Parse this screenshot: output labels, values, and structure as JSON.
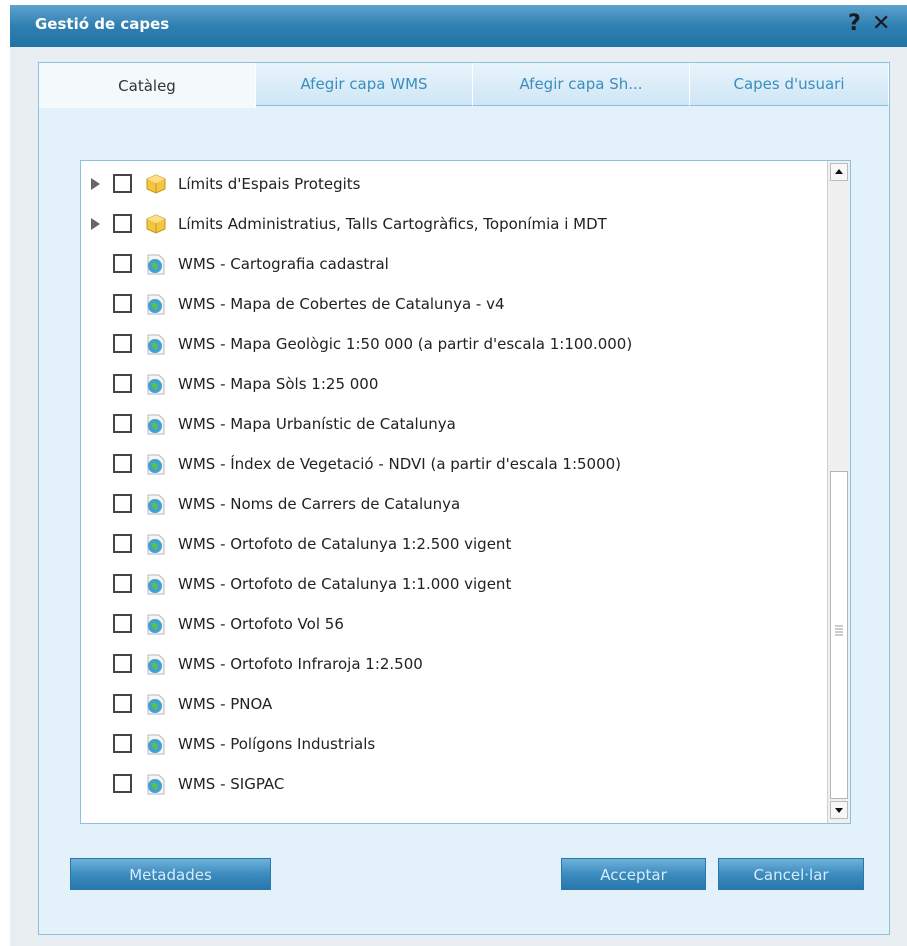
{
  "dialog": {
    "title": "Gestió de capes",
    "help_label": "?",
    "close_label": "✕",
    "tabs": [
      {
        "label": "Catàleg",
        "active": true
      },
      {
        "label": "Afegir capa WMS",
        "active": false
      },
      {
        "label": "Afegir capa Sh...",
        "active": false
      },
      {
        "label": "Capes d'usuari",
        "active": false
      }
    ],
    "layers": [
      {
        "label": "Límits d'Espais Protegits",
        "type": "group",
        "icon": "folder-cube-icon",
        "checked": false,
        "expandable": true
      },
      {
        "label": "Límits Administratius, Talls Cartogràfics, Toponímia i MDT",
        "type": "group",
        "icon": "folder-cube-icon",
        "checked": false,
        "expandable": true
      },
      {
        "label": "WMS - Cartografia cadastral",
        "type": "wms",
        "icon": "globe-icon",
        "checked": false,
        "expandable": false
      },
      {
        "label": "WMS - Mapa de Cobertes de Catalunya - v4",
        "type": "wms",
        "icon": "globe-icon",
        "checked": false,
        "expandable": false
      },
      {
        "label": "WMS - Mapa Geològic 1:50 000 (a partir d'escala 1:100.000)",
        "type": "wms",
        "icon": "globe-icon",
        "checked": false,
        "expandable": false
      },
      {
        "label": "WMS - Mapa Sòls 1:25 000",
        "type": "wms",
        "icon": "globe-icon",
        "checked": false,
        "expandable": false
      },
      {
        "label": "WMS - Mapa Urbanístic de Catalunya",
        "type": "wms",
        "icon": "globe-icon",
        "checked": false,
        "expandable": false
      },
      {
        "label": "WMS - Índex de Vegetació - NDVI (a partir d'escala 1:5000)",
        "type": "wms",
        "icon": "globe-icon",
        "checked": false,
        "expandable": false
      },
      {
        "label": "WMS - Noms de Carrers de Catalunya",
        "type": "wms",
        "icon": "globe-icon",
        "checked": false,
        "expandable": false
      },
      {
        "label": "WMS - Ortofoto de Catalunya 1:2.500 vigent",
        "type": "wms",
        "icon": "globe-icon",
        "checked": false,
        "expandable": false
      },
      {
        "label": "WMS - Ortofoto de Catalunya 1:1.000 vigent",
        "type": "wms",
        "icon": "globe-icon",
        "checked": false,
        "expandable": false
      },
      {
        "label": "WMS - Ortofoto Vol 56",
        "type": "wms",
        "icon": "globe-icon",
        "checked": false,
        "expandable": false
      },
      {
        "label": "WMS - Ortofoto Infraroja 1:2.500",
        "type": "wms",
        "icon": "globe-icon",
        "checked": false,
        "expandable": false
      },
      {
        "label": "WMS - PNOA",
        "type": "wms",
        "icon": "globe-icon",
        "checked": false,
        "expandable": false
      },
      {
        "label": "WMS - Polígons Industrials",
        "type": "wms",
        "icon": "globe-icon",
        "checked": false,
        "expandable": false
      },
      {
        "label": "WMS - SIGPAC",
        "type": "wms",
        "icon": "globe-icon",
        "checked": false,
        "expandable": false
      }
    ],
    "buttons": {
      "metadata": "Metadades",
      "accept": "Acceptar",
      "cancel": "Cancel·lar"
    },
    "colors": {
      "titlebar": "#2f7fb2",
      "panel": "#e3f1fa",
      "tab_text": "#3b8dbf",
      "button": "#3d8cc0"
    }
  }
}
